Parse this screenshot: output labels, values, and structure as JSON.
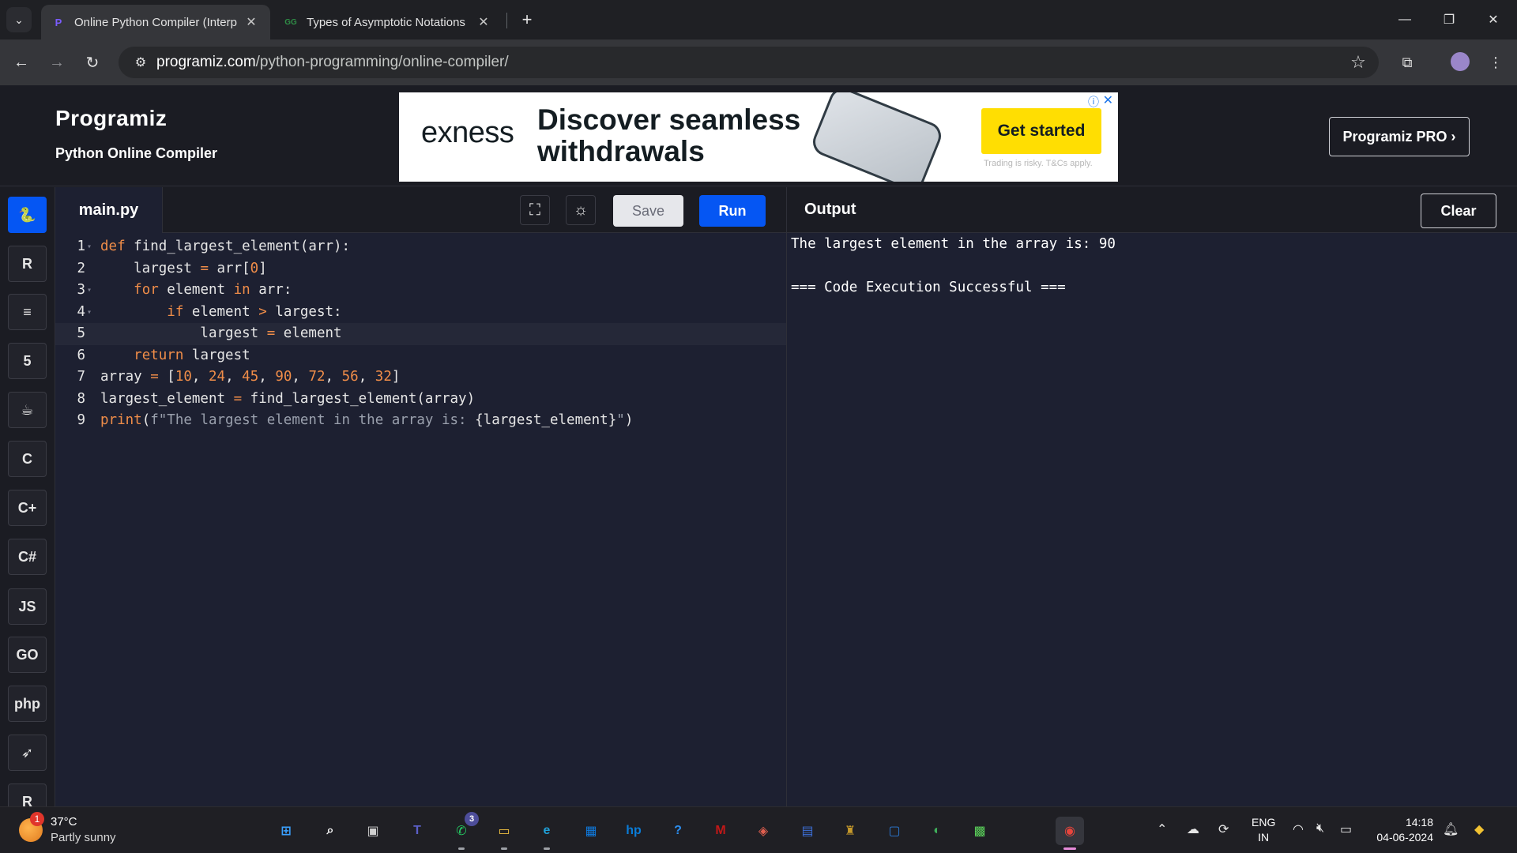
{
  "browser": {
    "tabs": [
      {
        "title": "Online Python Compiler (Interp",
        "favicon": "P",
        "active": true
      },
      {
        "title": "Types of Asymptotic Notations",
        "favicon": "GG",
        "active": false
      }
    ],
    "url_host": "programiz.com",
    "url_path": "/python-programming/online-compiler/",
    "icons": {
      "tab_menu": "chevron-down-icon",
      "close": "close-icon",
      "new_tab": "plus-icon",
      "back": "back-arrow-icon",
      "forward": "forward-arrow-icon",
      "reload": "reload-icon",
      "site_info": "site-info-icon",
      "bookmark": "star-icon",
      "extensions": "puzzle-icon",
      "menu": "kebab-menu-icon"
    }
  },
  "header": {
    "logo": "Programiz",
    "subtitle": "Python Online Compiler",
    "pro_button": "Programiz PRO ›",
    "ad": {
      "brand": "exness",
      "headline": "Discover seamless withdrawals",
      "cta": "Get started",
      "note": "Trading is risky. T&Cs apply."
    }
  },
  "rail": {
    "items": [
      {
        "name": "python",
        "glyph": "🐍",
        "active": true
      },
      {
        "name": "r",
        "glyph": "R",
        "active": false
      },
      {
        "name": "sql",
        "glyph": "≡",
        "active": false
      },
      {
        "name": "html",
        "glyph": "5",
        "active": false
      },
      {
        "name": "java",
        "glyph": "☕",
        "active": false
      },
      {
        "name": "c",
        "glyph": "C",
        "active": false
      },
      {
        "name": "cpp",
        "glyph": "C+",
        "active": false
      },
      {
        "name": "csharp",
        "glyph": "C#",
        "active": false
      },
      {
        "name": "javascript",
        "glyph": "JS",
        "active": false
      },
      {
        "name": "go",
        "glyph": "GO",
        "active": false
      },
      {
        "name": "php",
        "glyph": "php",
        "active": false
      },
      {
        "name": "swift",
        "glyph": "➶",
        "active": false
      },
      {
        "name": "rust",
        "glyph": "R",
        "active": false
      }
    ]
  },
  "editor": {
    "file_name": "main.py",
    "save_label": "Save",
    "run_label": "Run",
    "lines": [
      {
        "n": "1",
        "fold": true,
        "html": "<span class=\"kw\">def</span> find_largest_element(arr):"
      },
      {
        "n": "2",
        "fold": false,
        "html": "    largest <span class=\"op\">=</span> arr[<span class=\"num\">0</span>]"
      },
      {
        "n": "3",
        "fold": true,
        "html": "    <span class=\"kw\">for</span> element <span class=\"kw\">in</span> arr:"
      },
      {
        "n": "4",
        "fold": true,
        "html": "        <span class=\"kw\">if</span> element <span class=\"op\">&gt;</span> largest:"
      },
      {
        "n": "5",
        "fold": false,
        "html": "            largest <span class=\"op\">=</span> element"
      },
      {
        "n": "6",
        "fold": false,
        "html": "    <span class=\"kw\">return</span> largest"
      },
      {
        "n": "7",
        "fold": false,
        "html": "array <span class=\"op\">=</span> [<span class=\"num\">10</span>, <span class=\"num\">24</span>, <span class=\"num\">45</span>, <span class=\"num\">90</span>, <span class=\"num\">72</span>, <span class=\"num\">56</span>, <span class=\"num\">32</span>]"
      },
      {
        "n": "8",
        "fold": false,
        "html": "largest_element <span class=\"op\">=</span> find_largest_element(array)"
      },
      {
        "n": "9",
        "fold": false,
        "html": "<span class=\"kw\">print</span>(<span class=\"str\">f\"The largest element in the array is: </span>{largest_element}<span class=\"str\">\"</span>)"
      }
    ],
    "current_line": 5
  },
  "output": {
    "title": "Output",
    "clear_label": "Clear",
    "lines": [
      "The largest element in the array is: 90",
      "",
      "=== Code Execution Successful ==="
    ]
  },
  "taskbar": {
    "weather": {
      "temp": "37°C",
      "desc": "Partly sunny",
      "badge": "1"
    },
    "apps": [
      {
        "name": "start",
        "glyph": "⊞",
        "color": "#3aa0ff"
      },
      {
        "name": "search",
        "glyph": "⌕",
        "color": "#ffffff"
      },
      {
        "name": "task-view",
        "glyph": "▣",
        "color": "#d0d0d0"
      },
      {
        "name": "teams",
        "glyph": "T",
        "color": "#5b5fc7"
      },
      {
        "name": "whatsapp",
        "glyph": "✆",
        "color": "#25d366",
        "badge": "3"
      },
      {
        "name": "file-explorer",
        "glyph": "▭",
        "color": "#f5c542"
      },
      {
        "name": "edge",
        "glyph": "e",
        "color": "#1fa0d8"
      },
      {
        "name": "microsoft-store",
        "glyph": "▦",
        "color": "#0f7be0"
      },
      {
        "name": "myhp",
        "glyph": "hp",
        "color": "#0a7cd8"
      },
      {
        "name": "help",
        "glyph": "?",
        "color": "#2b8ef0"
      },
      {
        "name": "mcafee",
        "glyph": "M",
        "color": "#c01818"
      },
      {
        "name": "app-red",
        "glyph": "◈",
        "color": "#e25f4f"
      },
      {
        "name": "app-blue",
        "glyph": "▤",
        "color": "#3d6fd8"
      },
      {
        "name": "app-gold",
        "glyph": "♜",
        "color": "#c79a2b"
      },
      {
        "name": "app-window",
        "glyph": "▢",
        "color": "#2b7bd8"
      },
      {
        "name": "app-green",
        "glyph": "◐",
        "color": "#3fae5a"
      },
      {
        "name": "app-chip",
        "glyph": "▩",
        "color": "#5ad05a"
      },
      {
        "name": "chrome",
        "glyph": "◉",
        "color": "#e8453c"
      }
    ],
    "lang_top": "ENG",
    "lang_bottom": "IN",
    "time": "14:18",
    "date": "04-06-2024"
  }
}
